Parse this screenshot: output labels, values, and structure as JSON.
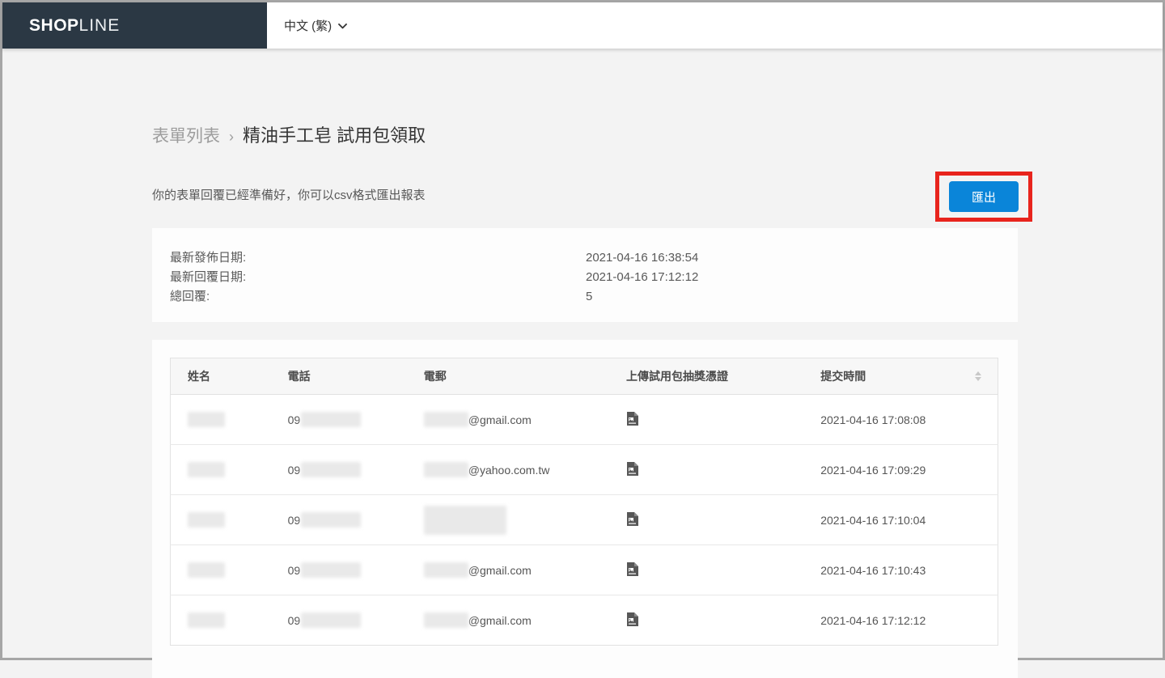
{
  "topbar": {
    "logo_bold": "SH",
    "logo_o": "O",
    "logo_bold2": "P",
    "logo_light": "LINE",
    "language": "中文 (繁)"
  },
  "breadcrumb": {
    "parent": "表單列表",
    "separator": "›",
    "current": "精油手工皂 試用包領取"
  },
  "description": "你的表單回覆已經準備好，你可以csv格式匯出報表",
  "export_button_label": "匯出",
  "summary": {
    "rows": [
      {
        "label": "最新發佈日期:",
        "value": "2021-04-16 16:38:54"
      },
      {
        "label": "最新回覆日期:",
        "value": "2021-04-16 17:12:12"
      },
      {
        "label": "總回覆:",
        "value": "5"
      }
    ]
  },
  "table": {
    "columns": [
      "姓名",
      "電話",
      "電郵",
      "上傳試用包抽獎憑證",
      "提交時間"
    ],
    "rows": [
      {
        "name_redacted": true,
        "phone_prefix": "09",
        "phone_redacted": true,
        "email_prefix_redacted": true,
        "email_suffix": "@gmail.com",
        "email_fully_redacted": false,
        "attachment_icon": "file-image-icon",
        "submitted": "2021-04-16 17:08:08"
      },
      {
        "name_redacted": true,
        "phone_prefix": "09",
        "phone_redacted": true,
        "email_prefix_redacted": true,
        "email_suffix": "@yahoo.com.tw",
        "email_fully_redacted": false,
        "attachment_icon": "file-image-icon",
        "submitted": "2021-04-16 17:09:29"
      },
      {
        "name_redacted": true,
        "phone_prefix": "09",
        "phone_redacted": true,
        "email_prefix_redacted": true,
        "email_suffix": "",
        "email_fully_redacted": true,
        "attachment_icon": "file-image-icon",
        "submitted": "2021-04-16 17:10:04"
      },
      {
        "name_redacted": true,
        "phone_prefix": "09",
        "phone_redacted": true,
        "email_prefix_redacted": true,
        "email_suffix": "@gmail.com",
        "email_fully_redacted": false,
        "attachment_icon": "file-image-icon",
        "submitted": "2021-04-16 17:10:43"
      },
      {
        "name_redacted": true,
        "phone_prefix": "09",
        "phone_redacted": true,
        "email_prefix_redacted": true,
        "email_suffix": "@gmail.com",
        "email_fully_redacted": false,
        "attachment_icon": "file-image-icon",
        "submitted": "2021-04-16 17:12:12"
      }
    ]
  },
  "colors": {
    "topbar_dark": "#2b3844",
    "accent_blue": "#0a85d9",
    "annotation_red": "#e8241d",
    "page_background": "#f3f3f3"
  }
}
